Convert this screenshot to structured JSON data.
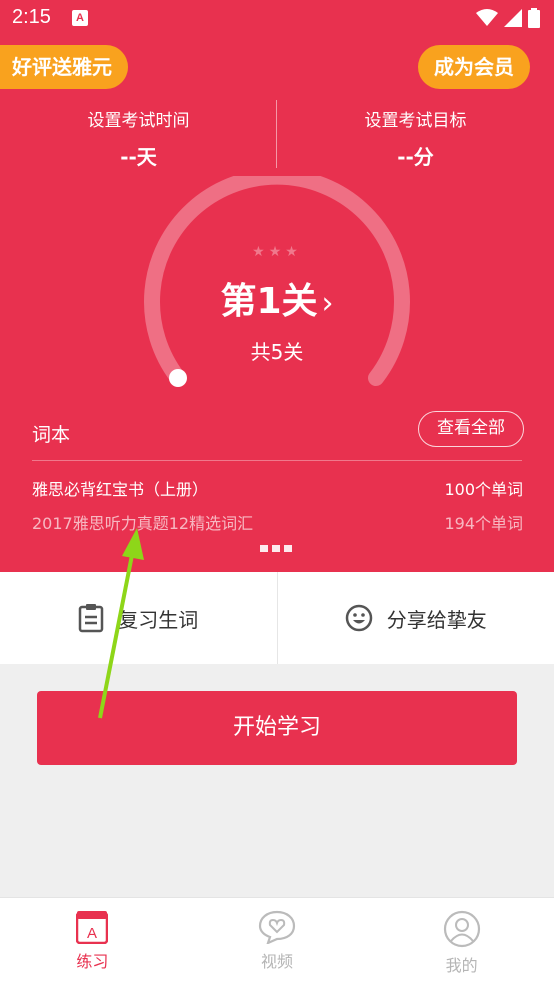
{
  "status_bar": {
    "time": "2:15",
    "app_icon_letter": "A"
  },
  "header": {
    "review_reward_label": "好评送雅元",
    "become_member_label": "成为会员"
  },
  "goals": {
    "exam_time": {
      "label": "设置考试时间",
      "value": "--天"
    },
    "exam_target": {
      "label": "设置考试目标",
      "value": "--分"
    }
  },
  "level": {
    "stars": "★★★",
    "title": "第1关",
    "chevron": "›",
    "total": "共5关"
  },
  "wordbook": {
    "title": "词本",
    "view_all_label": "查看全部",
    "books": [
      {
        "name": "雅思必背红宝书（上册）",
        "count": "100个单词"
      },
      {
        "name": "2017雅思听力真题12精选词汇",
        "count": "194个单词"
      }
    ]
  },
  "actions": {
    "review_label": "复习生词",
    "share_label": "分享给挚友"
  },
  "start_button_label": "开始学习",
  "tabs": [
    {
      "label": "练习",
      "icon": "book-a-icon",
      "active": true
    },
    {
      "label": "视频",
      "icon": "heart-bubble-icon",
      "active": false
    },
    {
      "label": "我的",
      "icon": "user-icon",
      "active": false
    }
  ],
  "colors": {
    "primary": "#e8314f",
    "accent": "#f9a21e",
    "annotation_arrow": "#8ed619"
  }
}
